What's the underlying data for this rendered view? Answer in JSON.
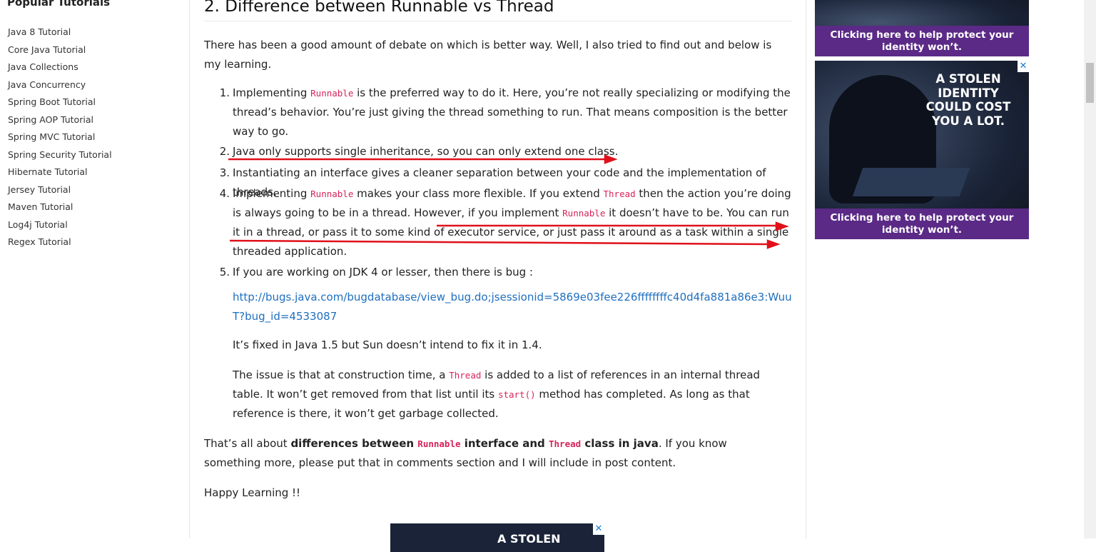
{
  "sidebar": {
    "title": "Popular Tutorials",
    "items": [
      "Java 8 Tutorial",
      "Core Java Tutorial",
      "Java Collections",
      "Java Concurrency",
      "Spring Boot Tutorial",
      "Spring AOP Tutorial",
      "Spring MVC Tutorial",
      "Spring Security Tutorial",
      "Hibernate Tutorial",
      "Jersey Tutorial",
      "Maven Tutorial",
      "Log4j Tutorial",
      "Regex Tutorial"
    ]
  },
  "article": {
    "heading": "2. Difference between Runnable vs Thread",
    "intro": "There has been a good amount of debate on which is better way. Well, I also tried to find out and below is my learning.",
    "list": {
      "n1": "1.",
      "n2": "2.",
      "n3": "3.",
      "n4": "4.",
      "n5": "5.",
      "item1_a": "Implementing ",
      "item1_code": "Runnable",
      "item1_b": " is the preferred way to do it. Here, you’re not really specializing or modifying the thread’s behavior. You’re just giving the thread something to run. That means composition is the better way to go.",
      "item2": "Java only supports single inheritance, so you can only extend one class.",
      "item3": "Instantiating an interface gives a cleaner separation between your code and the implementation of threads.",
      "item4_a": "Implementing ",
      "item4_code1": "Runnable",
      "item4_b": " makes your class more flexible. If you extend ",
      "item4_code2": "Thread",
      "item4_c": " then the action you’re doing is always going to be in a thread. However, if you implement ",
      "item4_code3": "Runnable",
      "item4_d": " it doesn’t have to be. You can run it in a thread, or pass it to some kind of executor service, or just pass it around as a task within a single threaded application.",
      "item5": "If you are working on JDK 4 or lesser, then there is bug :",
      "item5_link": "http://bugs.java.com/bugdatabase/view_bug.do;jsessionid=5869e03fee226ffffffffc40d4fa881a86e3:WuuT?bug_id=4533087",
      "item5_fixed": "It’s fixed in Java 1.5 but Sun doesn’t intend to fix it in 1.4.",
      "item5_issue_a": "The issue is that at construction time, a ",
      "item5_issue_code1": "Thread",
      "item5_issue_b": " is added to a list of references in an internal thread table. It won’t get removed from that list until its ",
      "item5_issue_code2": "start()",
      "item5_issue_c": " method has completed. As long as that reference is there, it won’t get garbage collected."
    },
    "summary_a": "That’s all about ",
    "summary_b1": "differences between ",
    "summary_code1": "Runnable",
    "summary_b2": " interface and ",
    "summary_code2": "Thread",
    "summary_b3": " class in java",
    "summary_c": ". If you know something more, please put that in comments section and I will include in post content.",
    "closing": "Happy Learning !!"
  },
  "ads": {
    "top_banner": "Clicking here to help protect your identity won’t.",
    "second_headline": "A STOLEN IDENTITY COULD COST YOU A LOT.",
    "second_banner": "Clicking here to help protect your identity won’t.",
    "bottom_headline": "A STOLEN",
    "close_glyph": "✕"
  },
  "colors": {
    "code": "#d6245a",
    "link": "#1f6fbf",
    "annotation_arrow": "#e0101a",
    "ad_banner": "#5b2a86"
  }
}
